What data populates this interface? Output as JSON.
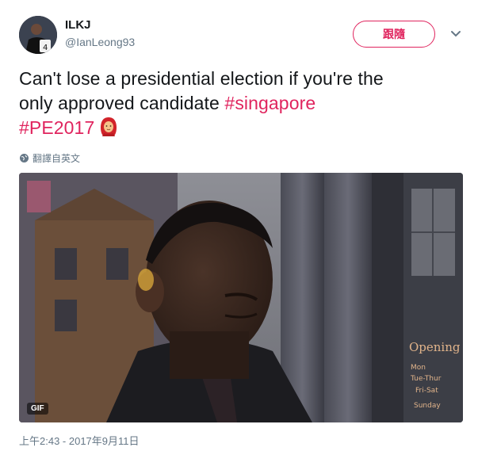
{
  "author": {
    "display_name": "ILKJ",
    "handle": "@IanLeong93"
  },
  "follow_label": "跟隨",
  "tweet": {
    "text_line1": "Can't lose a presidential election if you're the",
    "text_line2_prefix": "only approved candidate ",
    "hashtag_singapore": "#singapore",
    "hashtag_pe2017": "#PE2017",
    "emoji": "woman-with-headscarf-emoji"
  },
  "translate_label": "翻譯自英文",
  "media": {
    "badge": "GIF",
    "sign_text": "Opening\nMon\nTue-Thur\nFri-Sat\nSunday"
  },
  "timestamp": "上午2:43 - 2017年9月11日",
  "colors": {
    "accent": "#e0245e",
    "text": "#14171a",
    "secondary": "#657786"
  }
}
